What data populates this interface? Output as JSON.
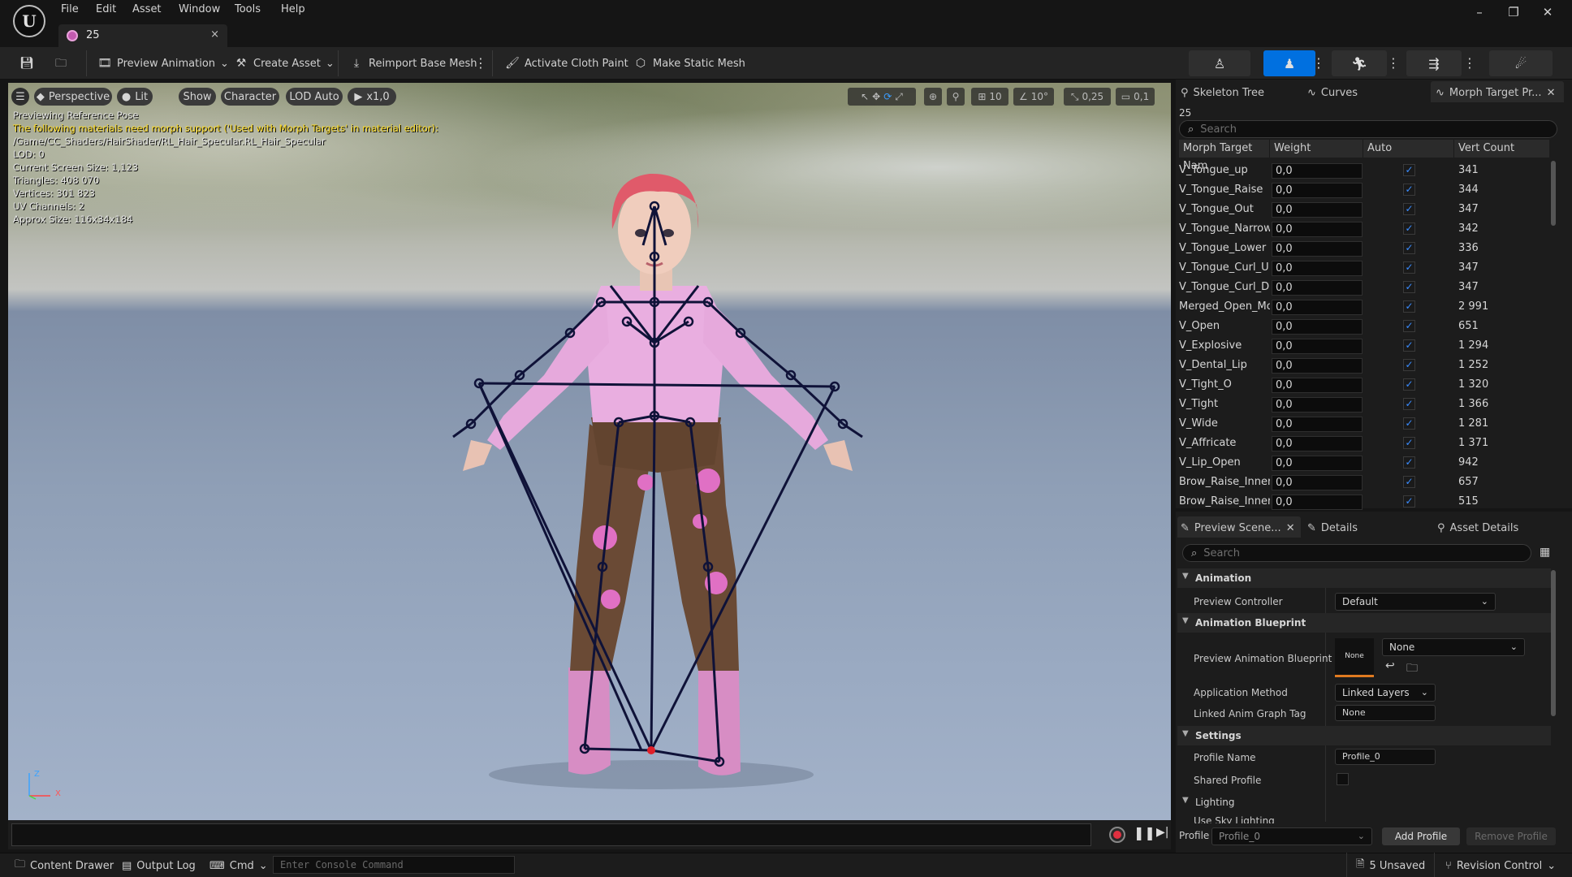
{
  "menu": [
    "File",
    "Edit",
    "Asset",
    "Window",
    "Tools",
    "Help"
  ],
  "tab": {
    "title": "25",
    "close": "×"
  },
  "toolbar": {
    "preview_animation": "Preview Animation",
    "create_asset": "Create Asset",
    "reimport_base_mesh": "Reimport Base Mesh",
    "activate_cloth_paint": "Activate Cloth Paint",
    "make_static_mesh": "Make Static Mesh"
  },
  "viewport": {
    "perspective": "Perspective",
    "lit": "Lit",
    "show": "Show",
    "character": "Character",
    "lod": "LOD Auto",
    "play_rate": "x1,0",
    "grid_snap": "10",
    "rotation_snap": "10°",
    "scale_snap": "0,25",
    "camera_speed": "0,1",
    "info": [
      {
        "text": "Previewing Reference Pose",
        "warn": false
      },
      {
        "text": "The following materials need morph support ('Used with Morph Targets' in material editor):",
        "warn": true
      },
      {
        "text": "/Game/CC_Shaders/HairShader/RL_Hair_Specular.RL_Hair_Specular",
        "warn": false
      },
      {
        "text": "LOD: 0",
        "warn": false
      },
      {
        "text": "Current Screen Size: 1,123",
        "warn": false
      },
      {
        "text": "Triangles: 408 070",
        "warn": false
      },
      {
        "text": "Vertices: 301 823",
        "warn": false
      },
      {
        "text": "UV Channels: 2",
        "warn": false
      },
      {
        "text": "Approx Size: 116x34x184",
        "warn": false
      }
    ],
    "axis_z": "Z",
    "axis_x": "X"
  },
  "morph_panel": {
    "tabs": [
      "Skeleton Tree",
      "Curves",
      "Morph Target Pr..."
    ],
    "asset_name": "25",
    "search_placeholder": "Search",
    "columns": [
      "Morph Target Nam",
      "Weight",
      "Auto",
      "Vert Count"
    ],
    "rows": [
      {
        "name": "V_Tongue_up",
        "weight": "0,0",
        "auto": true,
        "count": "341"
      },
      {
        "name": "V_Tongue_Raise",
        "weight": "0,0",
        "auto": true,
        "count": "344"
      },
      {
        "name": "V_Tongue_Out",
        "weight": "0,0",
        "auto": true,
        "count": "347"
      },
      {
        "name": "V_Tongue_Narrow",
        "weight": "0,0",
        "auto": true,
        "count": "342"
      },
      {
        "name": "V_Tongue_Lower",
        "weight": "0,0",
        "auto": true,
        "count": "336"
      },
      {
        "name": "V_Tongue_Curl_U",
        "weight": "0,0",
        "auto": true,
        "count": "347"
      },
      {
        "name": "V_Tongue_Curl_D",
        "weight": "0,0",
        "auto": true,
        "count": "347"
      },
      {
        "name": "Merged_Open_Mout",
        "weight": "0,0",
        "auto": true,
        "count": "2 991"
      },
      {
        "name": "V_Open",
        "weight": "0,0",
        "auto": true,
        "count": "651"
      },
      {
        "name": "V_Explosive",
        "weight": "0,0",
        "auto": true,
        "count": "1 294"
      },
      {
        "name": "V_Dental_Lip",
        "weight": "0,0",
        "auto": true,
        "count": "1 252"
      },
      {
        "name": "V_Tight_O",
        "weight": "0,0",
        "auto": true,
        "count": "1 320"
      },
      {
        "name": "V_Tight",
        "weight": "0,0",
        "auto": true,
        "count": "1 366"
      },
      {
        "name": "V_Wide",
        "weight": "0,0",
        "auto": true,
        "count": "1 281"
      },
      {
        "name": "V_Affricate",
        "weight": "0,0",
        "auto": true,
        "count": "1 371"
      },
      {
        "name": "V_Lip_Open",
        "weight": "0,0",
        "auto": true,
        "count": "942"
      },
      {
        "name": "Brow_Raise_Inner_I",
        "weight": "0,0",
        "auto": true,
        "count": "657"
      },
      {
        "name": "Brow_Raise_Inner_I",
        "weight": "0,0",
        "auto": true,
        "count": "515"
      }
    ]
  },
  "details_panel": {
    "tabs": [
      "Preview Scene...",
      "Details",
      "Asset Details"
    ],
    "search_placeholder": "Search",
    "sections": {
      "animation": "Animation",
      "animation_blueprint": "Animation Blueprint",
      "settings": "Settings",
      "lighting": "Lighting"
    },
    "props": {
      "preview_controller": "Preview Controller",
      "preview_controller_value": "Default",
      "preview_anim_bp": "Preview Animation Blueprint",
      "anim_bp_thumb": "None",
      "anim_bp_value": "None",
      "application_method": "Application Method",
      "application_method_value": "Linked Layers",
      "linked_anim_graph_tag": "Linked Anim Graph Tag",
      "linked_anim_graph_tag_value": "None",
      "profile_name": "Profile Name",
      "profile_name_value": "Profile_0",
      "shared_profile": "Shared Profile",
      "use_sky_lighting": "Use Sky Lighting"
    },
    "footer": {
      "profile_label": "Profile",
      "profile_value": "Profile_0",
      "add_profile": "Add Profile",
      "remove_profile": "Remove Profile"
    }
  },
  "statusbar": {
    "content_drawer": "Content Drawer",
    "output_log": "Output Log",
    "cmd": "Cmd",
    "console_placeholder": "Enter Console Command",
    "unsaved": "5 Unsaved",
    "revision_control": "Revision Control"
  }
}
